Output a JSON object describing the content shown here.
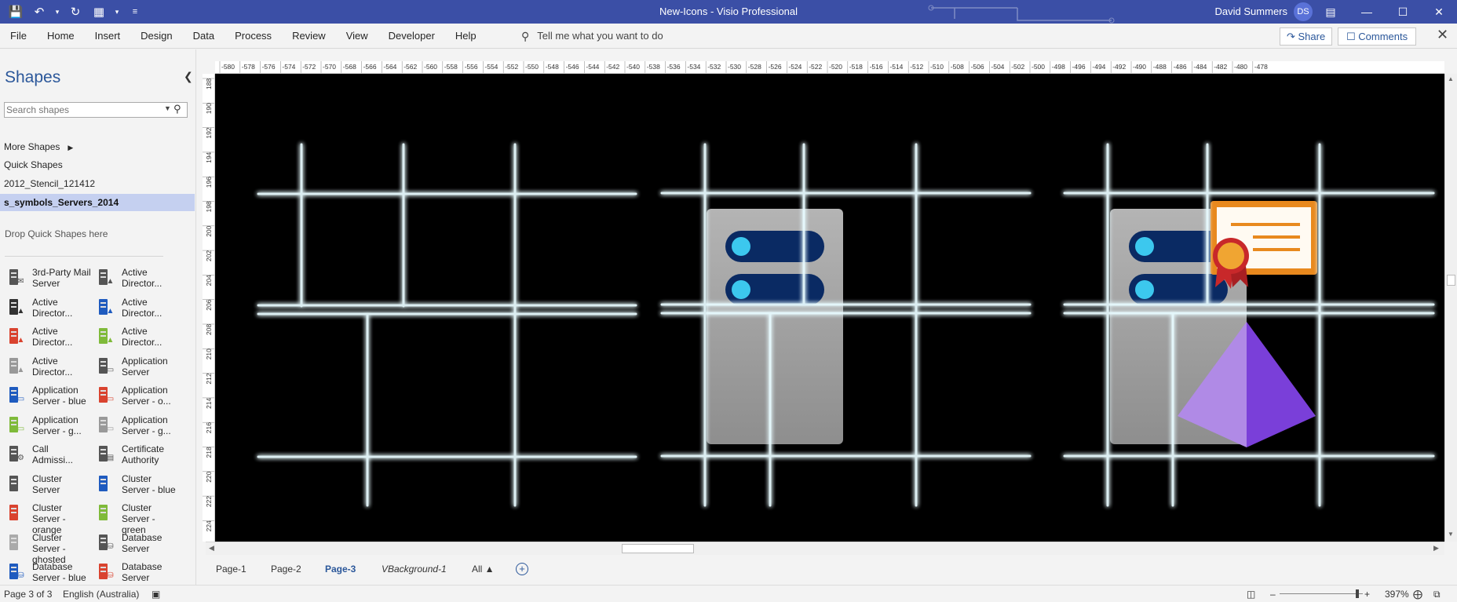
{
  "window": {
    "title": "New-Icons  -  Visio Professional",
    "user_name": "David Summers",
    "user_initials": "DS",
    "controls": [
      "ribbon-display",
      "minimize",
      "maximize",
      "close"
    ]
  },
  "quick_access": [
    "save",
    "undo",
    "redo",
    "view",
    "customize"
  ],
  "ribbon": {
    "tabs": [
      "File",
      "Home",
      "Insert",
      "Design",
      "Data",
      "Process",
      "Review",
      "View",
      "Developer",
      "Help"
    ],
    "tell_me": "Tell me what you want to do",
    "share": "Share",
    "comments": "Comments"
  },
  "shapes_pane": {
    "title": "Shapes",
    "search_placeholder": "Search shapes",
    "more_shapes": "More Shapes",
    "quick_shapes": "Quick Shapes",
    "stencils": [
      "2012_Stencil_121412",
      "s_symbols_Servers_2014"
    ],
    "active_stencil": "s_symbols_Servers_2014",
    "drop_hint": "Drop Quick Shapes here",
    "items": [
      {
        "label": "3rd-Party Mail Server",
        "badge_color": "#555555",
        "badge": "✉"
      },
      {
        "label": "Active Director...",
        "badge_color": "#555555",
        "badge": "▲"
      },
      {
        "label": "Active Director...",
        "badge_color": "#333333",
        "badge": "▲"
      },
      {
        "label": "Active Director...",
        "badge_color": "#1f5bbf",
        "badge": "▲"
      },
      {
        "label": "Active Director...",
        "badge_color": "#d9432f",
        "badge": "▲"
      },
      {
        "label": "Active Director...",
        "badge_color": "#7fba3a",
        "badge": "▲"
      },
      {
        "label": "Active Director...",
        "badge_color": "#999999",
        "badge": "▲"
      },
      {
        "label": "Application Server",
        "badge_color": "#555555",
        "badge": "▭"
      },
      {
        "label": "Application Server - blue",
        "badge_color": "#1f5bbf",
        "badge": "▭"
      },
      {
        "label": "Application Server - o...",
        "badge_color": "#d9432f",
        "badge": "▭"
      },
      {
        "label": "Application Server - g...",
        "badge_color": "#7fba3a",
        "badge": "▭"
      },
      {
        "label": "Application Server - g...",
        "badge_color": "#999999",
        "badge": "▭"
      },
      {
        "label": "Call Admissi...",
        "badge_color": "#555555",
        "badge": "⚙"
      },
      {
        "label": "Certificate Authority",
        "badge_color": "#555555",
        "badge": "▤"
      },
      {
        "label": "Cluster Server",
        "badge_color": "#555555",
        "badge": ""
      },
      {
        "label": "Cluster Server - blue",
        "badge_color": "#1f5bbf",
        "badge": ""
      },
      {
        "label": "Cluster Server - orange",
        "badge_color": "#d9432f",
        "badge": ""
      },
      {
        "label": "Cluster Server - green",
        "badge_color": "#7fba3a",
        "badge": ""
      },
      {
        "label": "Cluster Server - ghosted",
        "badge_color": "#aaaaaa",
        "badge": ""
      },
      {
        "label": "Database Server",
        "badge_color": "#555555",
        "badge": "⛁"
      },
      {
        "label": "Database Server - blue",
        "badge_color": "#1f5bbf",
        "badge": "⛁"
      },
      {
        "label": "Database Server",
        "badge_color": "#d9432f",
        "badge": "⛁"
      }
    ]
  },
  "ruler_top_labels": [
    "-580",
    "-578",
    "-576",
    "-574",
    "-572",
    "-570",
    "-568",
    "-566",
    "-564",
    "-562",
    "-560",
    "-558",
    "-556",
    "-554",
    "-552",
    "-550",
    "-548",
    "-546",
    "-544",
    "-542",
    "-540",
    "-538",
    "-536",
    "-534",
    "-532",
    "-530",
    "-528",
    "-526",
    "-524",
    "-522",
    "-520",
    "-518",
    "-516",
    "-514",
    "-512",
    "-510",
    "-508",
    "-506",
    "-504",
    "-502",
    "-500",
    "-498",
    "-496",
    "-494",
    "-492",
    "-490",
    "-488",
    "-486",
    "-484",
    "-482",
    "-480",
    "-478"
  ],
  "ruler_left_labels": [
    "188",
    "190",
    "192",
    "194",
    "196",
    "198",
    "200",
    "202",
    "204",
    "206",
    "208",
    "210",
    "212",
    "214",
    "216",
    "218",
    "220",
    "222",
    "224"
  ],
  "page_tabs": {
    "tabs": [
      "Page-1",
      "Page-2",
      "Page-3",
      "VBackground-1"
    ],
    "active": "Page-3",
    "all": "All ▲"
  },
  "status_bar": {
    "page": "Page 3 of 3",
    "language": "English (Australia)",
    "zoom": "397%"
  },
  "colors": {
    "title_bar": "#3b4fa6",
    "accent": "#2b579a",
    "glow_line": "#e8fbff",
    "glow": "#5ad0e8",
    "server_body": "#a8a8a8",
    "server_slot": "#0a2a63",
    "server_led": "#3cc8ee",
    "cert_border": "#e8891e",
    "ribbon_red": "#c8282a",
    "pyramid_light": "#b08ae6",
    "pyramid_dark": "#7a3fd9"
  }
}
